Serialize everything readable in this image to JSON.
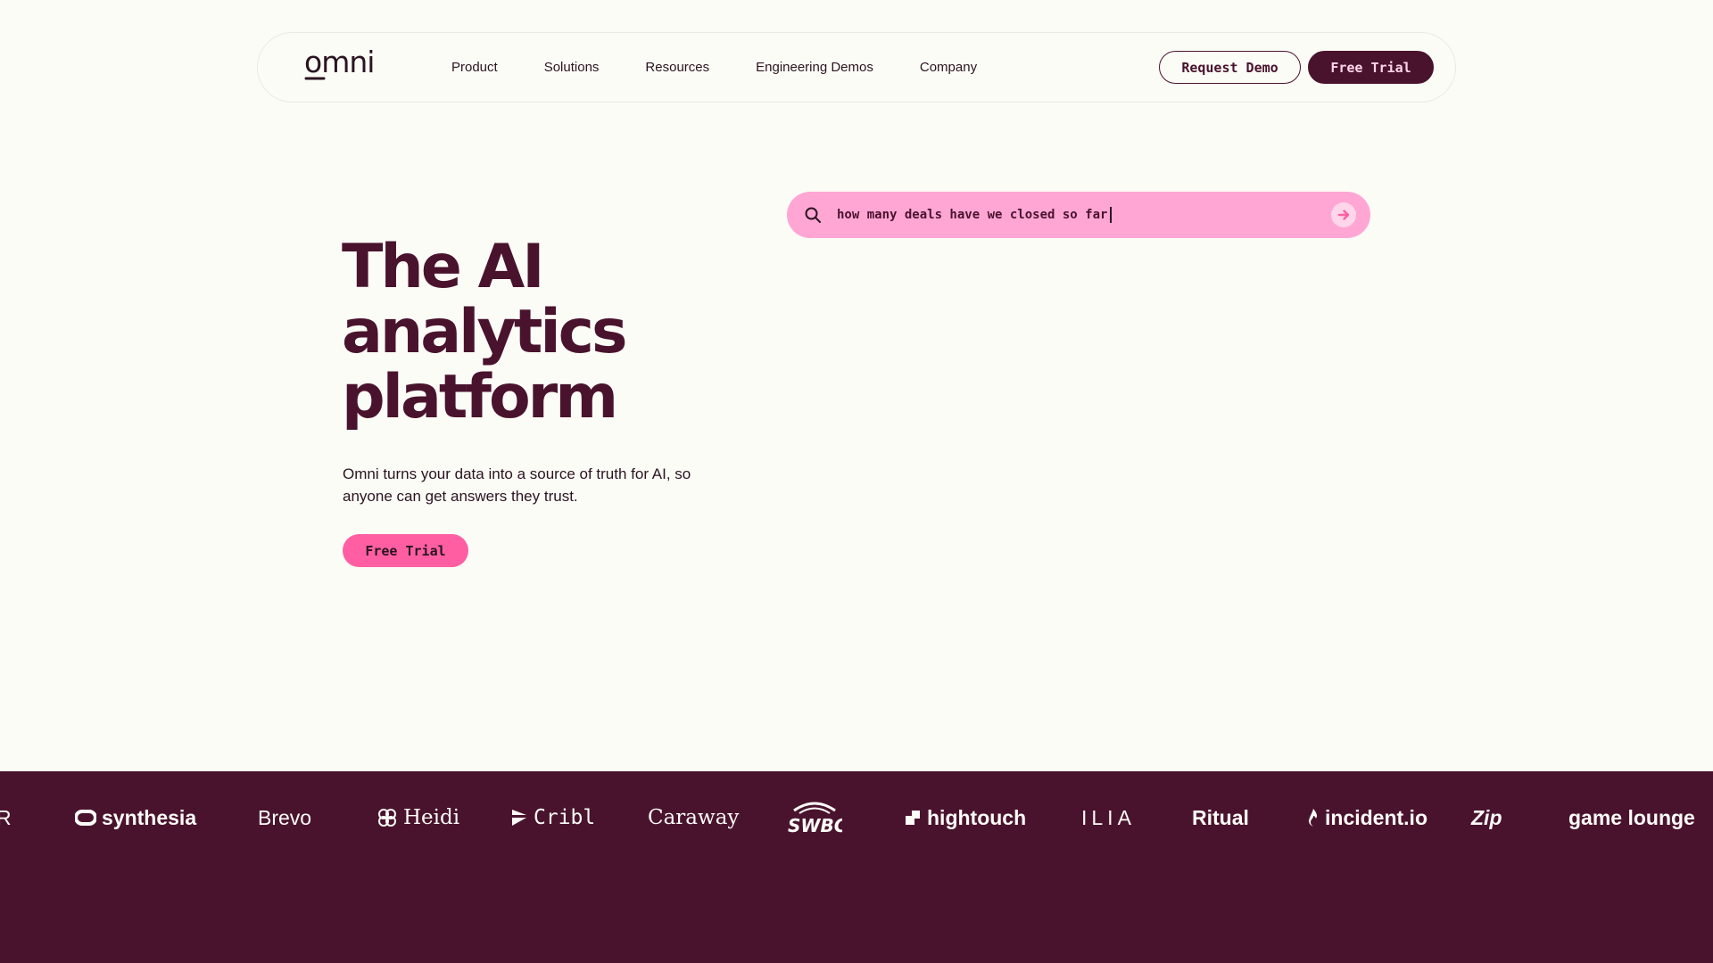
{
  "nav": {
    "logo_text": "omni",
    "links": [
      "Product",
      "Solutions",
      "Resources",
      "Engineering Demos",
      "Company"
    ],
    "request_demo": "Request Demo",
    "free_trial": "Free Trial"
  },
  "hero": {
    "title_lines": [
      "The AI",
      "analytics",
      "platform"
    ],
    "subtitle": "Omni turns your data into a source of truth for AI, so anyone can get answers they trust.",
    "cta": "Free Trial"
  },
  "search": {
    "query": "how many deals have we closed so far",
    "icon": "search-icon",
    "submit_icon": "arrow-right-circle-icon"
  },
  "logos": {
    "partial": "R",
    "brands": [
      "synthesia",
      "Brevo",
      "Heidi",
      "Cribl",
      "Caraway",
      "SWBC.",
      "hightouch",
      "ILIA",
      "Ritual",
      "incident.io",
      "Zip",
      "game lounge"
    ]
  },
  "colors": {
    "background": "#fcfcf7",
    "brand_dark": "#4a132d",
    "accent_pink": "#ff5fa2",
    "search_pink": "#ffa6d5"
  }
}
